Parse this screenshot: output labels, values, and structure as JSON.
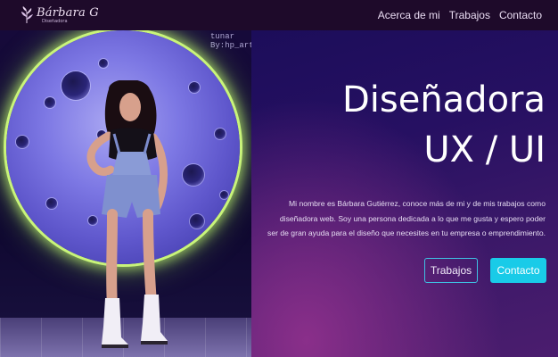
{
  "brand": {
    "name": "Bárbara G",
    "subtitle": "Diseñadora"
  },
  "nav": {
    "items": [
      "Acerca de mi",
      "Trabajos",
      "Contacto"
    ]
  },
  "photo": {
    "wall_text_line1": "tunar",
    "wall_text_line2": "By:hp_art_"
  },
  "hero": {
    "title_line1": "Diseñadora",
    "title_line2": "UX / UI",
    "description": "Mi nombre es Bárbara Gutiérrez, conoce más de mi y de mis trabajos como diseñadora web. Soy una persona dedicada a lo que me gusta y espero poder ser de gran ayuda para el diseño que necesites en tu empresa o emprendimiento.",
    "buttons": {
      "works": "Trabajos",
      "contact": "Contacto"
    }
  },
  "colors": {
    "header_bg": "#1e0a2a",
    "accent_cyan": "#19cbe8",
    "moon_glow": "#c9f47a"
  }
}
